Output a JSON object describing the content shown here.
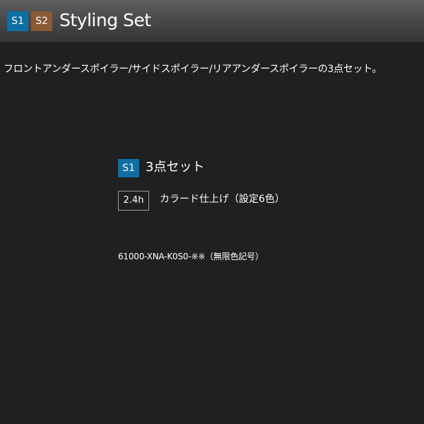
{
  "header": {
    "badge_s1": "S1",
    "badge_s2": "S2",
    "title": "Styling Set"
  },
  "description": "フロントアンダースポイラー/サイドスポイラー/リアアンダースポイラーの3点セット。",
  "item": {
    "badge": "S1",
    "title": "3点セット",
    "labor_time": "2.4h",
    "finish": "カラード仕上げ（設定6色）",
    "part_number": "61000-XNA-K0S0-※※（無限色記号）"
  },
  "colors": {
    "background": "#1f2021",
    "badge_s1": "#0f6ea3",
    "badge_s2": "#8a5a36",
    "header_gradient_top": "#5d5e60",
    "header_gradient_bottom": "#333436"
  }
}
